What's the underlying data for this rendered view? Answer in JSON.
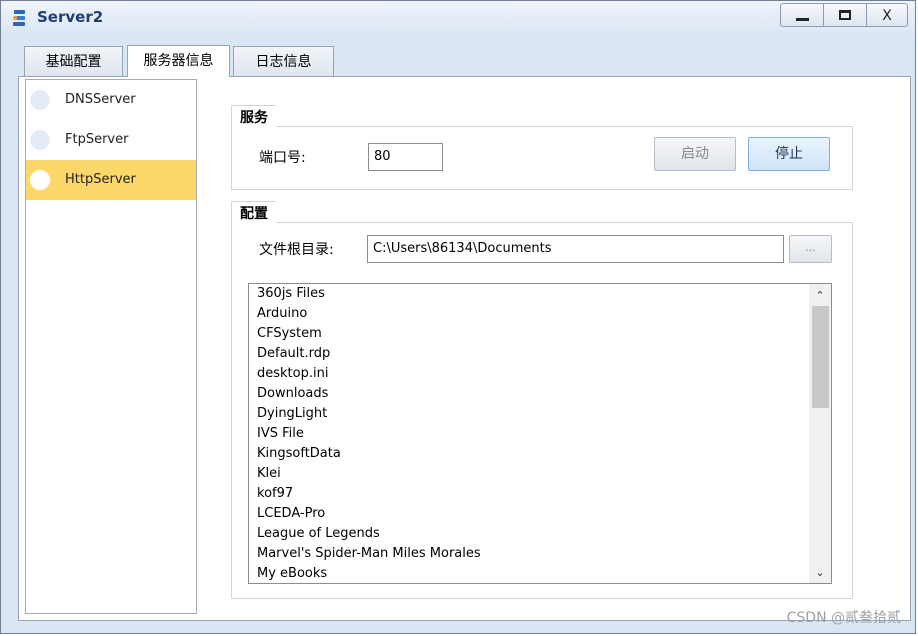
{
  "window": {
    "title": "Server2",
    "icon": "server-app-icon"
  },
  "controls": {
    "minimize": "",
    "maximize": "",
    "close": "X"
  },
  "tabs": [
    {
      "label": "基础配置"
    },
    {
      "label": "服务器信息"
    },
    {
      "label": "日志信息"
    }
  ],
  "servers": [
    {
      "label": "DNSServer"
    },
    {
      "label": "FtpServer"
    },
    {
      "label": "HttpServer",
      "selected": true
    }
  ],
  "service": {
    "group_label": "服务",
    "port_label": "端口号:",
    "port_value": "80",
    "start_label": "启动",
    "stop_label": "停止"
  },
  "config": {
    "group_label": "配置",
    "root_label": "文件根目录:",
    "root_value": "C:\\Users\\86134\\Documents",
    "browse_label": "...",
    "files": [
      "360js Files",
      "Arduino",
      "CFSystem",
      "Default.rdp",
      "desktop.ini",
      "Downloads",
      "DyingLight",
      "IVS File",
      "KingsoftData",
      "Klei",
      "kof97",
      "LCEDA-Pro",
      "League of Legends",
      "Marvel's Spider-Man Miles Morales",
      "My eBooks"
    ]
  },
  "colors": {
    "selected_bg": "#fcd86a",
    "title_color": "#1e3f72"
  },
  "watermark": "CSDN @贰叁拾贰"
}
